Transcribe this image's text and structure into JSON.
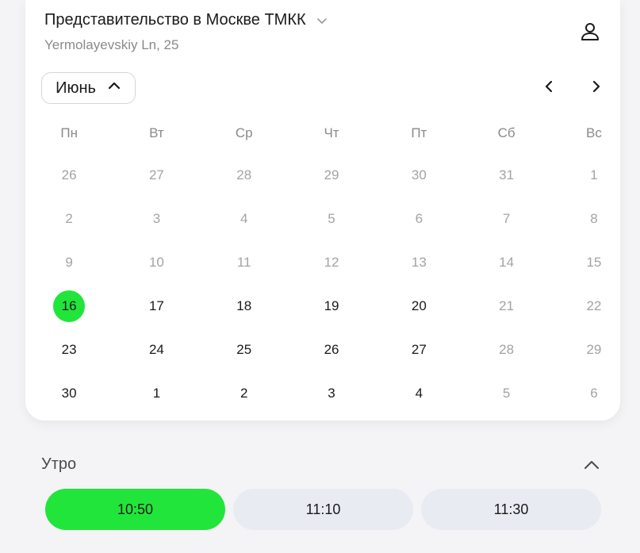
{
  "header": {
    "title": "Представительство в Москве ТМКК",
    "subtitle": "Yermolayevskiy Ln, 25"
  },
  "calendar": {
    "month_label": "Июнь",
    "weekdays": [
      "Пн",
      "Вт",
      "Ср",
      "Чт",
      "Пт",
      "Сб",
      "Вс"
    ],
    "weeks": [
      [
        {
          "d": "26",
          "s": "inactive"
        },
        {
          "d": "27",
          "s": "inactive"
        },
        {
          "d": "28",
          "s": "inactive"
        },
        {
          "d": "29",
          "s": "inactive"
        },
        {
          "d": "30",
          "s": "inactive"
        },
        {
          "d": "31",
          "s": "inactive"
        },
        {
          "d": "1",
          "s": "inactive"
        }
      ],
      [
        {
          "d": "2",
          "s": "inactive"
        },
        {
          "d": "3",
          "s": "inactive"
        },
        {
          "d": "4",
          "s": "inactive"
        },
        {
          "d": "5",
          "s": "inactive"
        },
        {
          "d": "6",
          "s": "inactive"
        },
        {
          "d": "7",
          "s": "inactive"
        },
        {
          "d": "8",
          "s": "inactive"
        }
      ],
      [
        {
          "d": "9",
          "s": "inactive"
        },
        {
          "d": "10",
          "s": "inactive"
        },
        {
          "d": "11",
          "s": "inactive"
        },
        {
          "d": "12",
          "s": "inactive"
        },
        {
          "d": "13",
          "s": "inactive"
        },
        {
          "d": "14",
          "s": "inactive"
        },
        {
          "d": "15",
          "s": "inactive"
        }
      ],
      [
        {
          "d": "16",
          "s": "selected"
        },
        {
          "d": "17",
          "s": "active"
        },
        {
          "d": "18",
          "s": "active"
        },
        {
          "d": "19",
          "s": "active"
        },
        {
          "d": "20",
          "s": "active"
        },
        {
          "d": "21",
          "s": "inactive"
        },
        {
          "d": "22",
          "s": "inactive"
        }
      ],
      [
        {
          "d": "23",
          "s": "active"
        },
        {
          "d": "24",
          "s": "active"
        },
        {
          "d": "25",
          "s": "active"
        },
        {
          "d": "26",
          "s": "active"
        },
        {
          "d": "27",
          "s": "active"
        },
        {
          "d": "28",
          "s": "inactive"
        },
        {
          "d": "29",
          "s": "inactive"
        }
      ],
      [
        {
          "d": "30",
          "s": "active"
        },
        {
          "d": "1",
          "s": "active"
        },
        {
          "d": "2",
          "s": "active"
        },
        {
          "d": "3",
          "s": "active"
        },
        {
          "d": "4",
          "s": "active"
        },
        {
          "d": "5",
          "s": "inactive"
        },
        {
          "d": "6",
          "s": "inactive"
        }
      ]
    ]
  },
  "timeslots": {
    "section_title": "Утро",
    "slots": [
      {
        "time": "10:50",
        "selected": true
      },
      {
        "time": "11:10",
        "selected": false
      },
      {
        "time": "11:30",
        "selected": false
      }
    ]
  },
  "colors": {
    "accent": "#22e53b",
    "slot_bg": "#e8ebf2",
    "muted_text": "#8a8a8a"
  },
  "icons": {
    "location_dropdown": "chevron-down-icon",
    "user": "user-icon",
    "month_toggle": "chevron-up-icon",
    "prev": "chevron-left-icon",
    "next": "chevron-right-icon",
    "collapse": "chevron-up-icon"
  }
}
